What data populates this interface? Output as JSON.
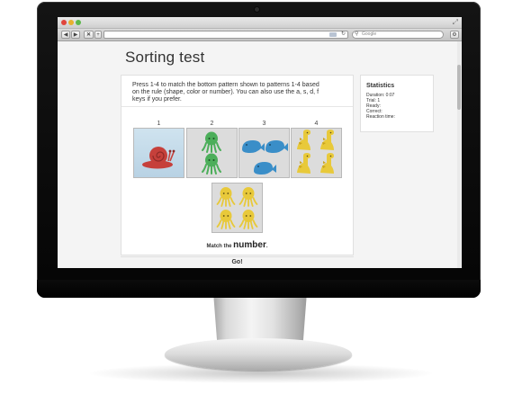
{
  "browser": {
    "search_placeholder": "Google",
    "new_tab_label": "+",
    "rss_badge": "RSS"
  },
  "page": {
    "title": "Sorting test",
    "instructions": "Press 1-4 to match the bottom pattern shown to patterns 1-4 based on the rule (shape, color or number). You can also use the a, s, d, f keys if you prefer.",
    "cards": [
      {
        "number": "1",
        "shape": "snail",
        "color": "red",
        "count": 1
      },
      {
        "number": "2",
        "shape": "octopus",
        "color": "green",
        "count": 2
      },
      {
        "number": "3",
        "shape": "whale",
        "color": "blue",
        "count": 3
      },
      {
        "number": "4",
        "shape": "dinosaur",
        "color": "yellow",
        "count": 4
      }
    ],
    "target_card": {
      "shape": "octopus",
      "color": "yellow",
      "count": 4
    },
    "match_prefix": "Match the",
    "match_rule": "number",
    "match_suffix": ".",
    "go_label": "Go!"
  },
  "statistics": {
    "title": "Statistics",
    "duration_label": "Duration: 0:07",
    "trial_label": "Trial: 1",
    "ready_label": "Ready:",
    "correct_label": "Correct:",
    "reaction_label": "Reaction time:"
  },
  "colors": {
    "red": "#c6403b",
    "green": "#4cae5a",
    "blue": "#3a8ec8",
    "yellow": "#e8c93a"
  }
}
